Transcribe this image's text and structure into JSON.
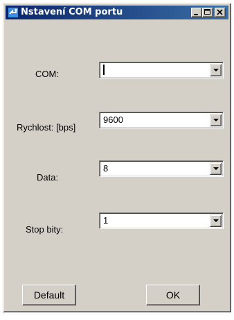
{
  "window": {
    "title": "Nstavení COM portu"
  },
  "titlebar_buttons": [
    "minimize-icon",
    "maximize-icon",
    "close-icon"
  ],
  "fields": [
    {
      "label": "COM:",
      "value": ""
    },
    {
      "label": "Rychlost: [bps]",
      "value": "9600"
    },
    {
      "label": "Data:",
      "value": "8"
    },
    {
      "label": "Stop bity:",
      "value": "1"
    }
  ],
  "buttons": {
    "default_label": "Default",
    "ok_label": "OK"
  },
  "colors": {
    "title_gradient_start": "#0a246a",
    "title_gradient_end": "#3a6ea5",
    "face": "#d4d0c8"
  }
}
